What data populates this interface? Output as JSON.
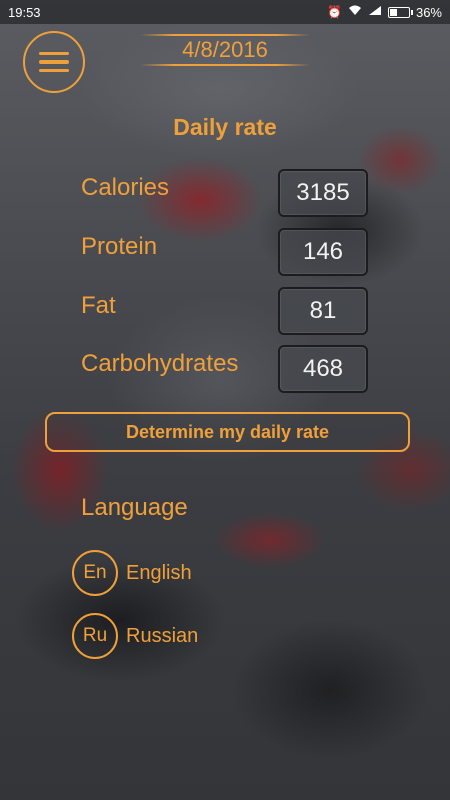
{
  "status_bar": {
    "time": "19:53",
    "battery": "36%",
    "battery_level": 0.36,
    "icons": [
      "alarm-icon",
      "wifi-icon",
      "signal-icon",
      "battery-icon"
    ]
  },
  "header": {
    "menu_icon": "hamburger-icon",
    "date": "4/8/2016"
  },
  "daily_rate": {
    "title": "Daily rate",
    "rows": [
      {
        "label": "Calories",
        "value": "3185"
      },
      {
        "label": "Protein",
        "value": "146"
      },
      {
        "label": "Fat",
        "value": "81"
      },
      {
        "label": "Carbohydrates",
        "value": "468"
      }
    ],
    "determine_button": "Determine my daily rate"
  },
  "language": {
    "title": "Language",
    "options": [
      {
        "code": "En",
        "name": "English"
      },
      {
        "code": "Ru",
        "name": "Russian"
      }
    ]
  },
  "colors": {
    "accent": "#f0a03a",
    "value_text": "#f2f2f2"
  }
}
